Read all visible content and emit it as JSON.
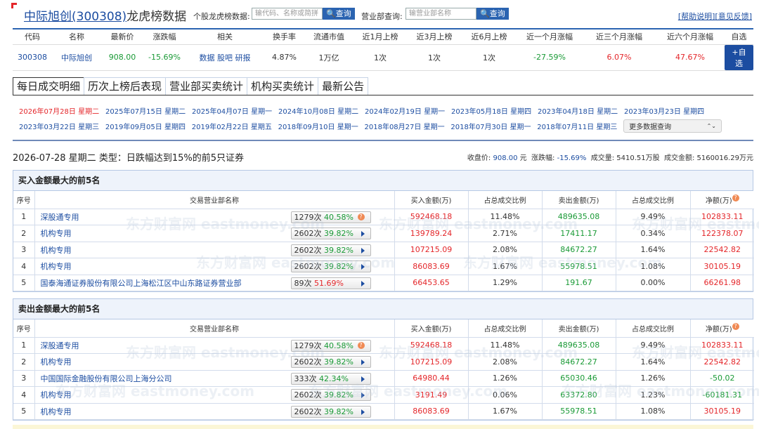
{
  "header": {
    "stock_name": "中际旭创",
    "stock_code": "(300308)",
    "title_suffix": "龙虎榜数据",
    "stock_search_label": "个股龙虎榜数据:",
    "stock_search_placeholder": "输代码、名称或简拼",
    "search_btn": "查询",
    "dept_search_label": "营业部查询:",
    "dept_search_placeholder": "输营业部名称",
    "dept_search_btn": "查询",
    "help_link": "[帮助说明]",
    "feedback_link": "[意见反馈]"
  },
  "quote": {
    "headers": [
      "代码",
      "名称",
      "最新价",
      "涨跌幅",
      "相关",
      "换手率",
      "流通市值",
      "近1月上榜",
      "近3月上榜",
      "近6月上榜",
      "近一个月涨幅",
      "近三个月涨幅",
      "近六个月涨幅",
      "自选"
    ],
    "code": "300308",
    "name": "中际旭创",
    "price": "908.00",
    "change": "-15.69%",
    "rel_data": "数据",
    "rel_guba": "股吧",
    "rel_report": "研报",
    "turnover": "4.87%",
    "float_cap": "1万亿",
    "m1": "1次",
    "m3": "1次",
    "m6": "1次",
    "chg1": "-27.59%",
    "chg3": "6.07%",
    "chg6": "47.67%",
    "add_btn": "+自选"
  },
  "tabs": [
    "每日成交明细",
    "历次上榜后表现",
    "营业部买卖统计",
    "机构买卖统计",
    "最新公告"
  ],
  "dates_row1": [
    "2026年07月28日 星期二",
    "2025年07月15日 星期二",
    "2025年04月07日 星期一",
    "2024年10月08日 星期二",
    "2024年02月19日 星期一",
    "2023年05月18日 星期四",
    "2023年04月18日 星期二",
    "2023年03月23日 星期四"
  ],
  "dates_row2": [
    "2023年03月22日 星期三",
    "2019年09月05日 星期四",
    "2019年02月22日 星期五",
    "2018年09月10日 星期一",
    "2018年08月27日 星期一",
    "2018年07月30日 星期一",
    "2018年07月11日 星期三"
  ],
  "more_select": "更多数据查询",
  "info": {
    "line": "2026-07-28 星期二 类型：日跌幅达到15%的前5只证券",
    "close_label": "收盘价:",
    "close_value": "908.00",
    "close_unit": "元",
    "chg_label": "涨跌幅:",
    "chg_value": "-15.69%",
    "vol_label": "成交量:",
    "vol_value": "5410.51万股",
    "amt_label": "成交金额:",
    "amt_value": "5160016.29万元"
  },
  "table_headers": [
    "序号",
    "交易营业部名称",
    "买入金额(万)",
    "占总成交比例",
    "卖出金额(万)",
    "占总成交比例",
    "净额(万)"
  ],
  "watermark": "东方财富网 eastmoney.com",
  "buy_table": {
    "title": "买入金额最大的前5名",
    "rows": [
      {
        "no": "1",
        "name": "深股通专用",
        "count": "1279次",
        "ratio": "40.58%",
        "ratio_color": "green",
        "icon": "help",
        "buy": "592468.18",
        "buy_pct": "11.48%",
        "sell": "489635.08",
        "sell_pct": "9.49%",
        "net": "102833.11",
        "net_color": "red"
      },
      {
        "no": "2",
        "name": "机构专用",
        "count": "2602次",
        "ratio": "39.82%",
        "ratio_color": "green",
        "icon": "arrow",
        "buy": "139789.24",
        "buy_pct": "2.71%",
        "sell": "17411.17",
        "sell_pct": "0.34%",
        "net": "122378.07",
        "net_color": "red"
      },
      {
        "no": "3",
        "name": "机构专用",
        "count": "2602次",
        "ratio": "39.82%",
        "ratio_color": "green",
        "icon": "arrow",
        "buy": "107215.09",
        "buy_pct": "2.08%",
        "sell": "84672.27",
        "sell_pct": "1.64%",
        "net": "22542.82",
        "net_color": "red"
      },
      {
        "no": "4",
        "name": "机构专用",
        "count": "2602次",
        "ratio": "39.82%",
        "ratio_color": "green",
        "icon": "arrow",
        "buy": "86083.69",
        "buy_pct": "1.67%",
        "sell": "55978.51",
        "sell_pct": "1.08%",
        "net": "30105.19",
        "net_color": "red"
      },
      {
        "no": "5",
        "name": "国泰海通证券股份有限公司上海松江区中山东路证券营业部",
        "count": "89次",
        "ratio": "51.69%",
        "ratio_color": "red",
        "icon": "arrow",
        "buy": "66453.65",
        "buy_pct": "1.29%",
        "sell": "191.67",
        "sell_pct": "0.00%",
        "net": "66261.98",
        "net_color": "red"
      }
    ]
  },
  "sell_table": {
    "title": "卖出金额最大的前5名",
    "rows": [
      {
        "no": "1",
        "name": "深股通专用",
        "count": "1279次",
        "ratio": "40.58%",
        "ratio_color": "green",
        "icon": "help",
        "buy": "592468.18",
        "buy_pct": "11.48%",
        "sell": "489635.08",
        "sell_pct": "9.49%",
        "net": "102833.11",
        "net_color": "red"
      },
      {
        "no": "2",
        "name": "机构专用",
        "count": "2602次",
        "ratio": "39.82%",
        "ratio_color": "green",
        "icon": "arrow",
        "buy": "107215.09",
        "buy_pct": "2.08%",
        "sell": "84672.27",
        "sell_pct": "1.64%",
        "net": "22542.82",
        "net_color": "red"
      },
      {
        "no": "3",
        "name": "中国国际金融股份有限公司上海分公司",
        "count": "333次",
        "ratio": "42.34%",
        "ratio_color": "green",
        "icon": "arrow",
        "buy": "64980.44",
        "buy_pct": "1.26%",
        "sell": "65030.46",
        "sell_pct": "1.26%",
        "net": "-50.02",
        "net_color": "green"
      },
      {
        "no": "4",
        "name": "机构专用",
        "count": "2602次",
        "ratio": "39.82%",
        "ratio_color": "green",
        "icon": "arrow",
        "buy": "3191.49",
        "buy_pct": "0.06%",
        "sell": "63372.80",
        "sell_pct": "1.23%",
        "net": "-60181.31",
        "net_color": "green"
      },
      {
        "no": "5",
        "name": "机构专用",
        "count": "2602次",
        "ratio": "39.82%",
        "ratio_color": "green",
        "icon": "arrow",
        "buy": "86083.69",
        "buy_pct": "1.67%",
        "sell": "55978.51",
        "sell_pct": "1.08%",
        "net": "30105.19",
        "net_color": "red"
      }
    ]
  },
  "colors": {
    "accent": "#2b64b1",
    "up": "#e4262a",
    "down": "#1a9a36",
    "link": "#1c4da1"
  }
}
